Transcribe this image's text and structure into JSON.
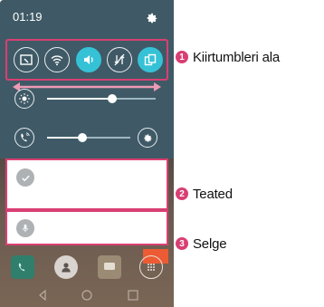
{
  "status_bar": {
    "time": "01:19",
    "settings_icon": "gear-icon"
  },
  "quick_settings": {
    "toggles": [
      {
        "name": "screen-capture",
        "icon": "capture-icon",
        "active": false
      },
      {
        "name": "wifi",
        "icon": "wifi-icon",
        "active": true
      },
      {
        "name": "sound",
        "icon": "sound-icon",
        "active": true
      },
      {
        "name": "data",
        "icon": "data-off-icon",
        "active": false
      },
      {
        "name": "dual-window",
        "icon": "dual-window-icon",
        "active": true
      }
    ],
    "brightness_level": 0.6,
    "volume_level": 0.42
  },
  "notifications": [
    {
      "icon": "check-icon"
    },
    {
      "icon": "mic-icon"
    }
  ],
  "callouts": [
    {
      "number": "1",
      "label": "Kiirtumbleri ala"
    },
    {
      "number": "2",
      "label": "Teated"
    },
    {
      "number": "3",
      "label": "Selge"
    }
  ],
  "colors": {
    "accent": "#36c2d6",
    "highlight": "#d93f73",
    "clear": "#ec5b33"
  }
}
